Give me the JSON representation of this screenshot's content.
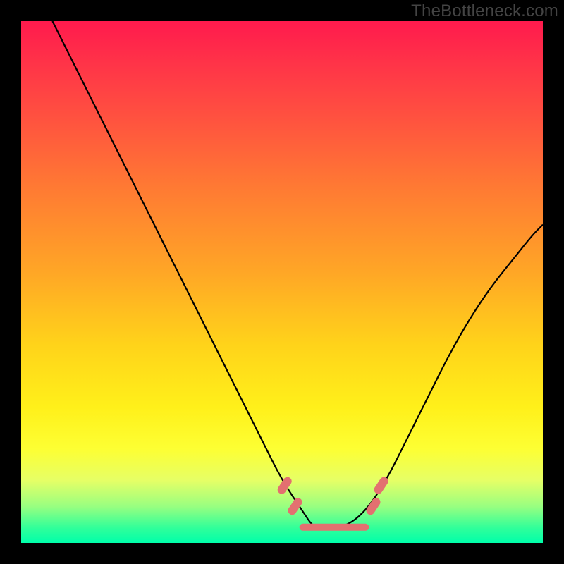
{
  "watermark": "TheBottleneck.com",
  "chart_data": {
    "type": "line",
    "title": "",
    "xlabel": "",
    "ylabel": "",
    "xlim": [
      0,
      100
    ],
    "ylim": [
      0,
      100
    ],
    "grid": false,
    "series": [
      {
        "name": "bottleneck-curve",
        "x": [
          6,
          10,
          14,
          18,
          22,
          26,
          30,
          34,
          38,
          42,
          46,
          50,
          54,
          56,
          58,
          62,
          66,
          70,
          74,
          78,
          82,
          86,
          90,
          94,
          98,
          100
        ],
        "values": [
          100,
          92,
          84,
          76,
          68,
          60,
          52,
          44,
          36,
          28,
          20,
          12,
          6,
          3,
          3,
          3,
          6,
          12,
          20,
          28,
          36,
          43,
          49,
          54,
          59,
          61
        ]
      }
    ],
    "flat_region": {
      "x_start": 54,
      "x_end": 66,
      "value": 3
    },
    "marks": [
      {
        "x": 50.5,
        "value": 11
      },
      {
        "x": 52.5,
        "value": 7
      },
      {
        "x": 67.5,
        "value": 7
      },
      {
        "x": 69.0,
        "value": 11
      }
    ],
    "background_gradient": {
      "stops": [
        {
          "pos": 0.0,
          "color": "#ff1a4d"
        },
        {
          "pos": 0.08,
          "color": "#ff3348"
        },
        {
          "pos": 0.18,
          "color": "#ff5040"
        },
        {
          "pos": 0.32,
          "color": "#ff7a33"
        },
        {
          "pos": 0.48,
          "color": "#ffa626"
        },
        {
          "pos": 0.62,
          "color": "#ffd31a"
        },
        {
          "pos": 0.74,
          "color": "#fff01a"
        },
        {
          "pos": 0.82,
          "color": "#fdff33"
        },
        {
          "pos": 0.88,
          "color": "#e6ff66"
        },
        {
          "pos": 0.93,
          "color": "#99ff80"
        },
        {
          "pos": 0.97,
          "color": "#33ff99"
        },
        {
          "pos": 1.0,
          "color": "#00ffaa"
        }
      ]
    }
  }
}
